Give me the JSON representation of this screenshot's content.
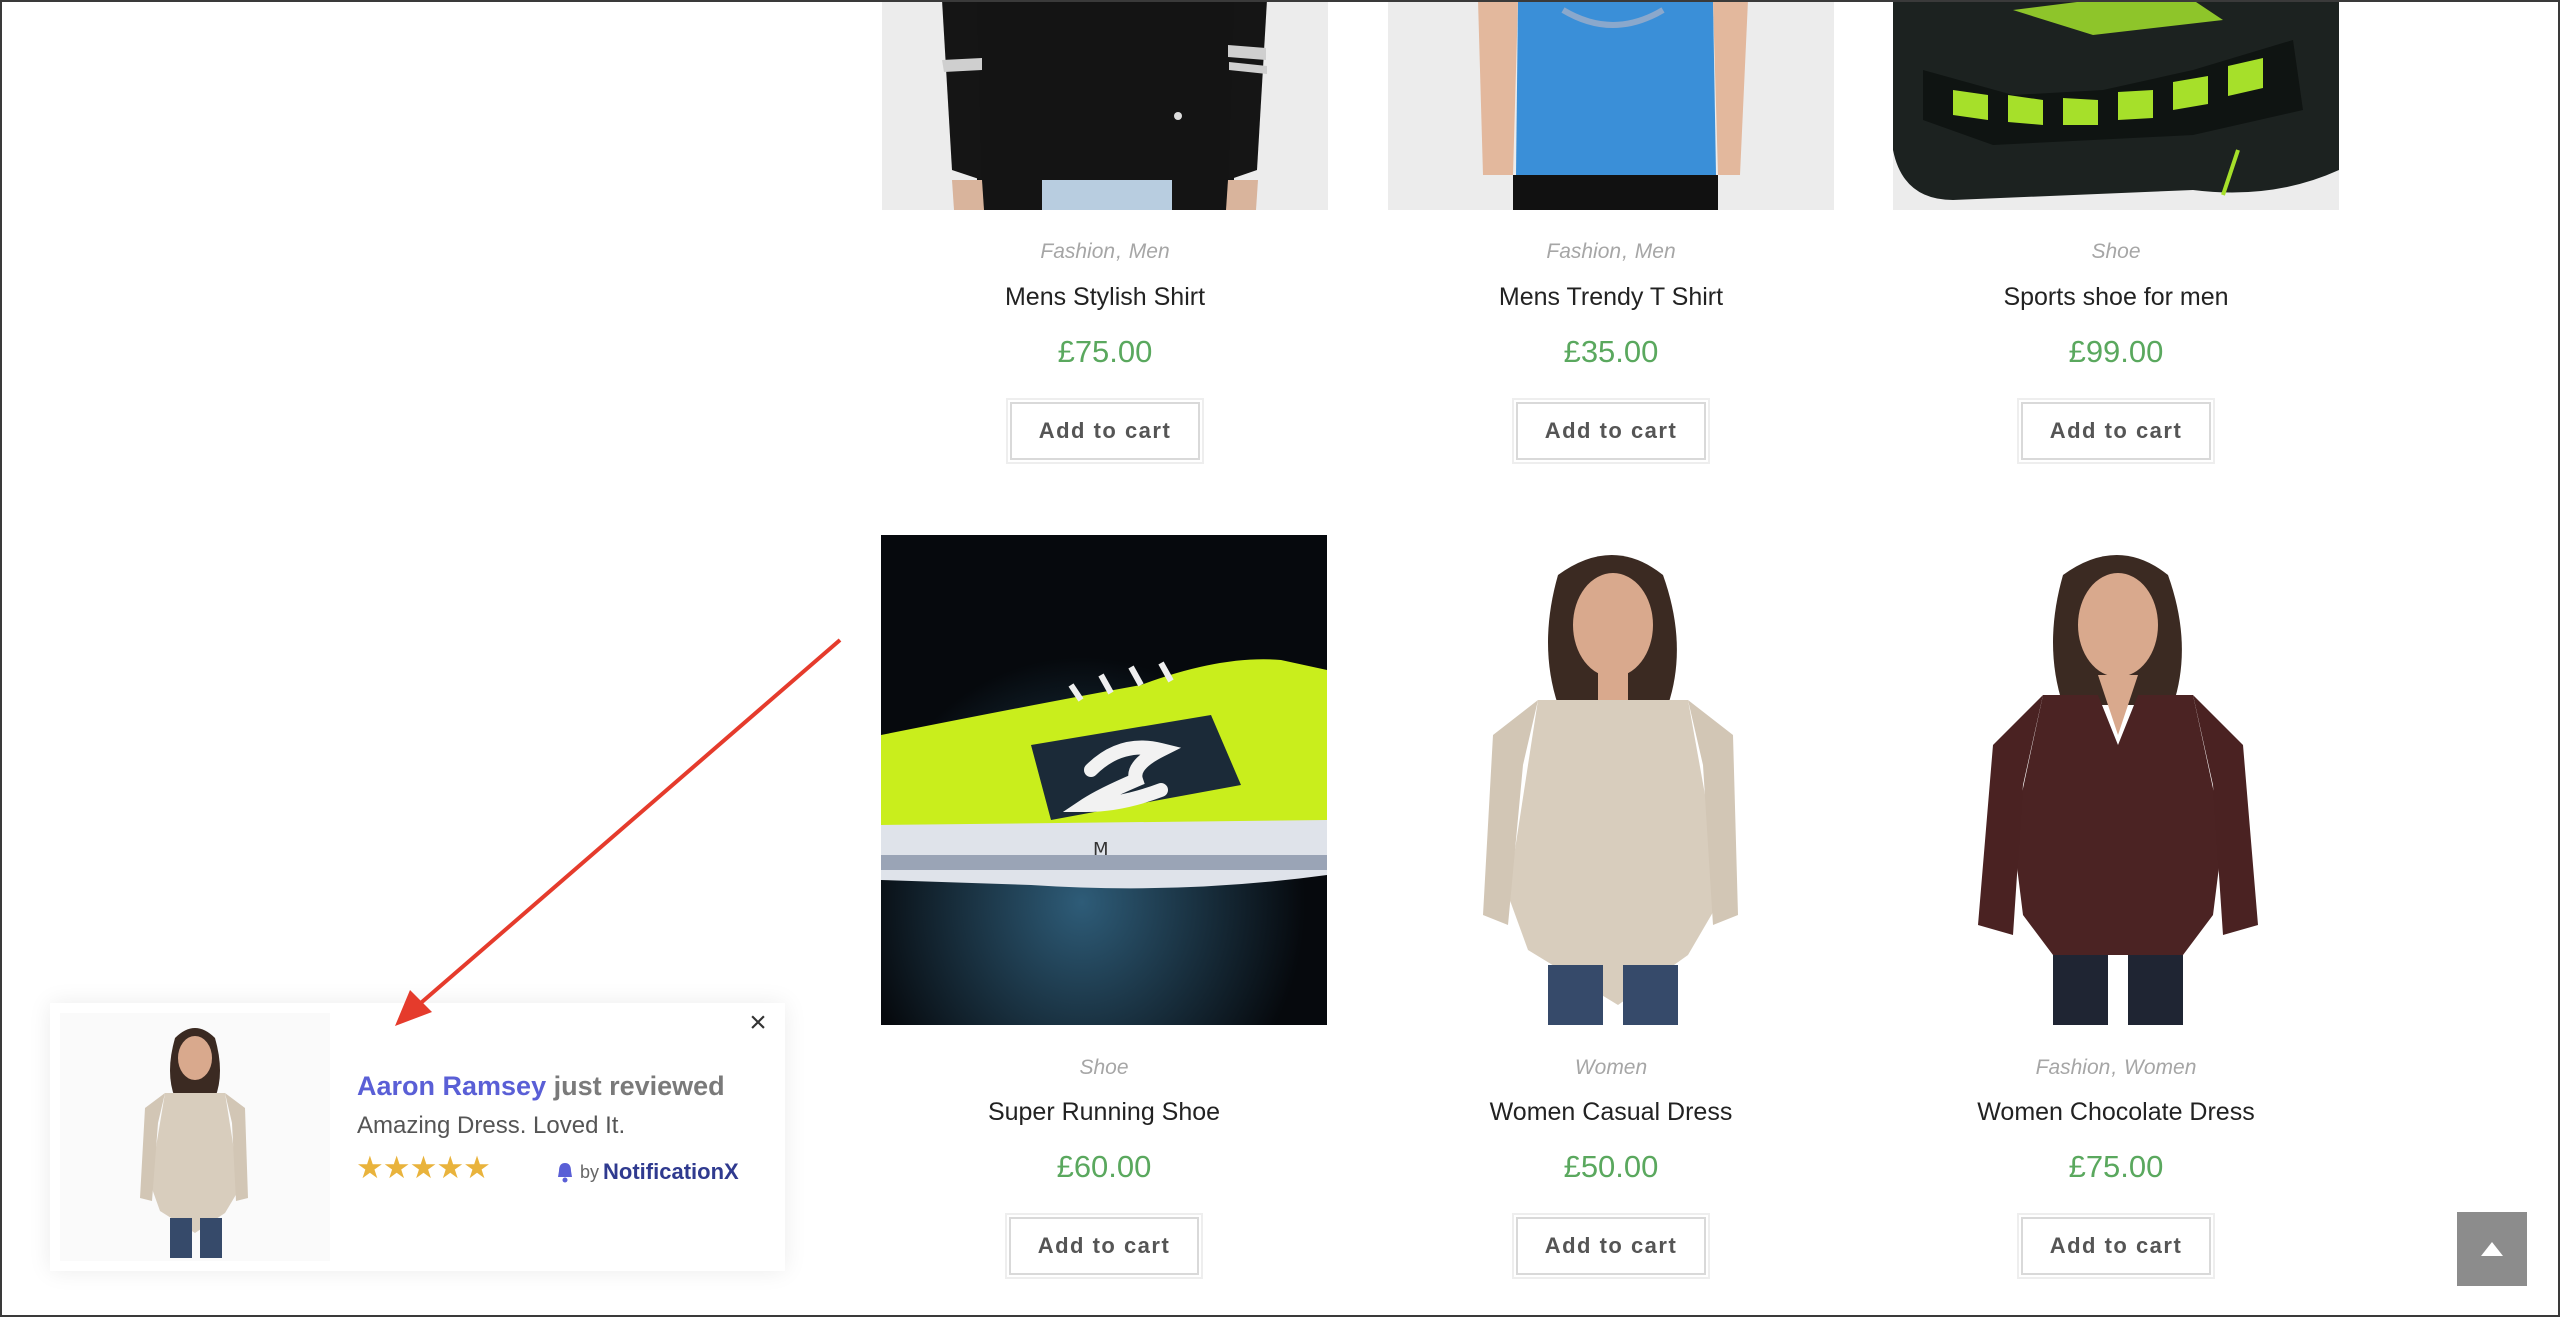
{
  "products": [
    {
      "categories": [
        "Fashion",
        "Men"
      ],
      "title": "Mens Stylish Shirt",
      "price": "£75.00",
      "button": "Add to cart",
      "image": "mens-stylish-shirt-image"
    },
    {
      "categories": [
        "Fashion",
        "Men"
      ],
      "title": "Mens Trendy T Shirt",
      "price": "£35.00",
      "button": "Add to cart",
      "image": "mens-trendy-t-shirt-image"
    },
    {
      "categories": [
        "Shoe"
      ],
      "title": "Sports shoe for men",
      "price": "£99.00",
      "button": "Add to cart",
      "image": "sports-shoe-image"
    },
    {
      "categories": [
        "Shoe"
      ],
      "title": "Super Running Shoe",
      "price": "£60.00",
      "button": "Add to cart",
      "image": "running-shoe-image"
    },
    {
      "categories": [
        "Women"
      ],
      "title": "Women Casual Dress",
      "price": "£50.00",
      "button": "Add to cart",
      "image": "women-casual-dress-image"
    },
    {
      "categories": [
        "Fashion",
        "Women"
      ],
      "title": "Women Chocolate Dress",
      "price": "£75.00",
      "button": "Add to cart",
      "image": "women-chocolate-dress-image"
    }
  ],
  "notification": {
    "name": "Aaron Ramsey",
    "action": "just reviewed",
    "review": "Amazing Dress. Loved It.",
    "rating": 5,
    "stars": "★★★★★",
    "by": "by",
    "brand": "NotificationX",
    "close": "×"
  },
  "colors": {
    "price": "#5aa85e",
    "name": "#5a5fd6",
    "star": "#e9b33c",
    "arrow": "#e53b2c",
    "brand": "#2f3a8f"
  },
  "icons": {
    "scroll_top": "chevron-up-icon",
    "close": "close-icon",
    "brand": "bell-icon"
  }
}
